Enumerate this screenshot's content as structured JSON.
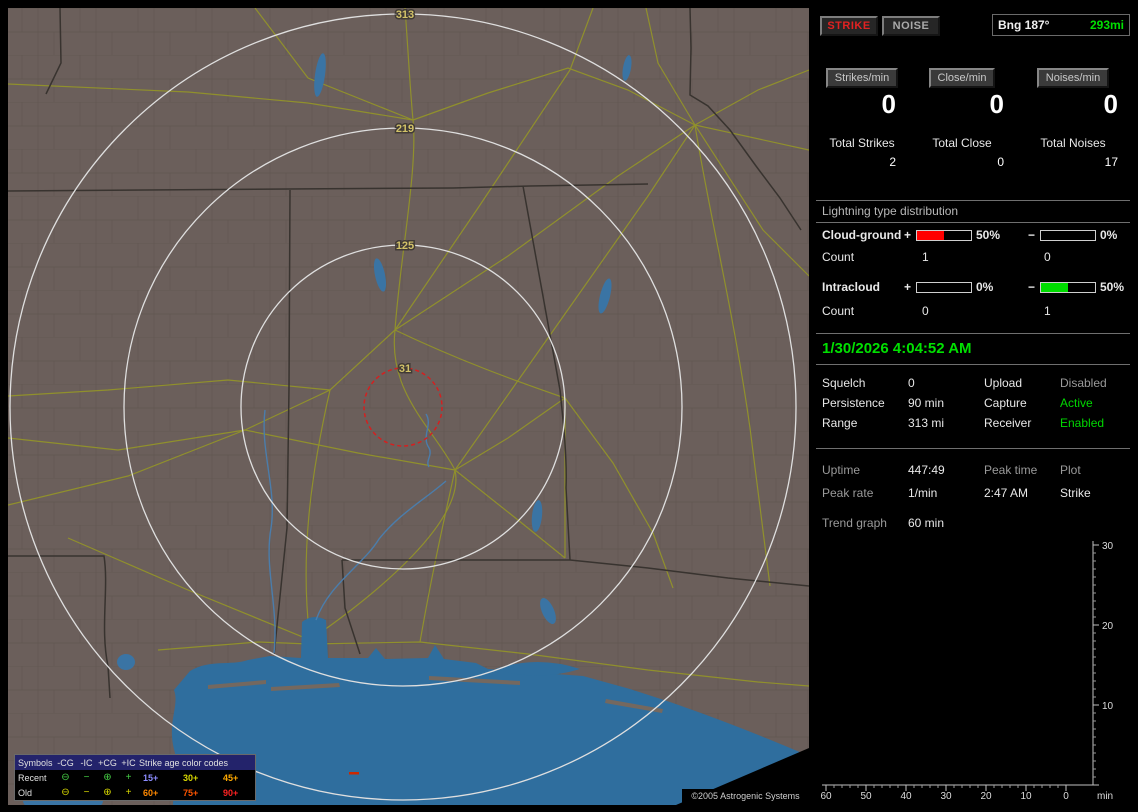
{
  "map": {
    "ring_labels": [
      "313",
      "219",
      "125",
      "31"
    ],
    "copyright": "©2005 Astrogenic Systems",
    "legend": {
      "symbols_header": "Symbols",
      "symbol_cols": [
        "-CG",
        "-IC",
        "+CG",
        "+IC"
      ],
      "age_header": "Strike age color codes",
      "symbol_glyphs": [
        "⊖",
        "−",
        "⊕",
        "+"
      ],
      "rows": [
        {
          "label": "Recent",
          "ages": [
            "15+",
            "30+",
            "45+"
          ]
        },
        {
          "label": "Old",
          "ages": [
            "60+",
            "75+",
            "90+"
          ]
        }
      ]
    }
  },
  "panel": {
    "strike_button": "STRIKE",
    "noise_button": "NOISE",
    "bearing_label": "Bng 187°",
    "bearing_distance": "293mi",
    "rate_headers": [
      "Strikes/min",
      "Close/min",
      "Noises/min"
    ],
    "rate_values": [
      "0",
      "0",
      "0"
    ],
    "total_labels": [
      "Total Strikes",
      "Total Close",
      "Total Noises"
    ],
    "total_values": [
      "2",
      "0",
      "17"
    ],
    "distribution": {
      "title": "Lightning type distribution",
      "cloud_ground": {
        "label": "Cloud-ground",
        "plus_sign": "+",
        "minus_sign": "−",
        "plus_pct": "50%",
        "minus_pct": "0%",
        "count_label": "Count",
        "plus_count": "1",
        "minus_count": "0"
      },
      "intracloud": {
        "label": "Intracloud",
        "plus_sign": "+",
        "minus_sign": "−",
        "plus_pct": "0%",
        "minus_pct": "50%",
        "count_label": "Count",
        "plus_count": "0",
        "minus_count": "1"
      }
    },
    "datetime": "1/30/2026 4:04:52 AM",
    "status_rows": [
      {
        "label": "Squelch",
        "value": "0",
        "label2": "Upload",
        "value2": "Disabled"
      },
      {
        "label": "Persistence",
        "value": "90 min",
        "label2": "Capture",
        "value2": "Active"
      },
      {
        "label": "Range",
        "value": "313 mi",
        "label2": "Receiver",
        "value2": "Enabled"
      }
    ],
    "info": {
      "uptime_label": "Uptime",
      "uptime_value": "447:49",
      "peak_time_label": "Peak time",
      "plot_label": "Plot",
      "peak_rate_label": "Peak rate",
      "peak_rate_value": "1/min",
      "peak_time_value": "2:47 AM",
      "plot_value": "Strike",
      "trend_label": "Trend graph",
      "trend_value": "60 min"
    },
    "graph": {
      "y_ticks": [
        "30",
        "20",
        "10"
      ],
      "x_ticks": [
        "60",
        "50",
        "40",
        "30",
        "20",
        "10",
        "0"
      ],
      "x_unit": "min"
    },
    "colors": {
      "strike_red": "#e22222",
      "positive_bar_fill": "#ff0000",
      "negative_bar_fill": "#00dd00",
      "active_green": "#00d800",
      "datetime_green": "#00e000",
      "disabled_gray": "#9a9a9a"
    }
  }
}
